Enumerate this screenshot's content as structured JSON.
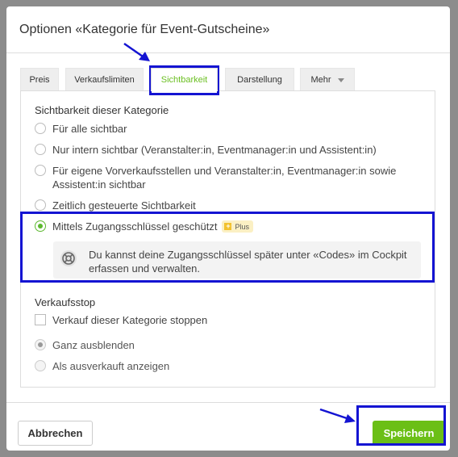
{
  "dialog": {
    "title": "Optionen «Kategorie für Event-Gutscheine»"
  },
  "tabs": [
    {
      "label": "Preis"
    },
    {
      "label": "Verkaufslimiten"
    },
    {
      "label": "Sichtbarkeit",
      "active": true
    },
    {
      "label": "Darstellung"
    },
    {
      "label": "Mehr"
    }
  ],
  "visibility": {
    "title": "Sichtbarkeit dieser Kategorie",
    "options": [
      {
        "label": "Für alle sichtbar",
        "checked": false
      },
      {
        "label": "Nur intern sichtbar (Veranstalter:in, Eventmanager:in und Assistent:in)",
        "checked": false
      },
      {
        "label": "Für eigene Vorverkaufsstellen und Veranstalter:in, Eventmanager:in sowie Assistent:in sichtbar",
        "checked": false
      },
      {
        "label": "Zeitlich gesteuerte Sichtbarkeit",
        "checked": false
      },
      {
        "label": "Mittels Zugangsschlüssel geschützt",
        "checked": true,
        "badge": "Plus"
      }
    ],
    "info": "Du kannst deine Zugangsschlüssel später unter «Codes» im Cockpit erfassen und verwalten."
  },
  "sales_stop": {
    "title": "Verkaufsstop",
    "checkbox_label": "Verkauf dieser Kategorie stoppen",
    "options": [
      {
        "label": "Ganz ausblenden",
        "checked": true
      },
      {
        "label": "Als ausverkauft anzeigen",
        "checked": false
      }
    ]
  },
  "footer": {
    "cancel_label": "Abbrechen",
    "save_label": "Speichern"
  },
  "colors": {
    "accent_green": "#6bbf16",
    "highlight_blue": "#1414d2",
    "badge_bg": "#fbf0c4"
  }
}
